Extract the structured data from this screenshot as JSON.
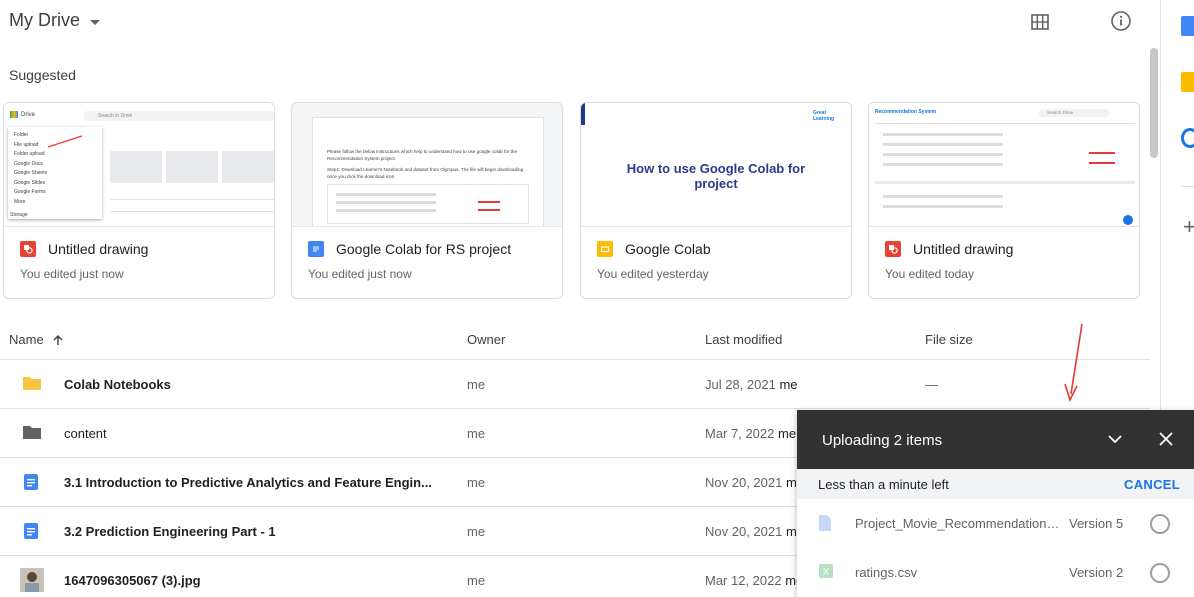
{
  "header": {
    "title": "My Drive"
  },
  "suggested": {
    "label": "Suggested",
    "cards": [
      {
        "name": "Untitled drawing",
        "edited": "You edited just now",
        "icon": "drawings-icon",
        "thumb_text": "",
        "thumb_mini": {
          "drive_label": "Drive",
          "search_placeholder": "Search in Drive",
          "menu_items": [
            "Folder",
            "File upload",
            "Folder upload",
            "Google Docs",
            "Google Sheets",
            "Google Slides",
            "Google Forms",
            "More"
          ],
          "storage_label": "Storage"
        }
      },
      {
        "name": "Google Colab for RS project",
        "edited": "You edited just now",
        "icon": "docs-icon",
        "thumb_text": "",
        "thumb_doc_line": "Please follow the below instructions which help to understand how to use google colab for the Recommendation System project.",
        "thumb_doc_step": "Step1: Download Learner's Notebook and dataset from Olympus. The file will begin downloading once you click the download icon."
      },
      {
        "name": "Google Colab",
        "edited": "You edited yesterday",
        "icon": "slides-icon",
        "thumb_text": "How to use Google Colab for project",
        "thumb_logo": "Great Learning"
      },
      {
        "name": "Untitled drawing",
        "edited": "You edited today",
        "icon": "drawings-icon",
        "thumb_text": "",
        "thumb_mini": {
          "header": "Recommendation System",
          "search_placeholder": "Search Drive"
        }
      }
    ]
  },
  "table": {
    "columns": {
      "name": "Name",
      "owner": "Owner",
      "modified": "Last modified",
      "size": "File size"
    },
    "rows": [
      {
        "name": "Colab Notebooks",
        "owner": "me",
        "modified": "Jul 28, 2021",
        "modified_by": "me",
        "size": "—",
        "icon": "folder-yellow-icon"
      },
      {
        "name": "content",
        "owner": "me",
        "modified": "Mar 7, 2022",
        "modified_by": "me",
        "size": "",
        "icon": "folder-gray-icon"
      },
      {
        "name": "3.1 Introduction to Predictive Analytics and Feature Engin...",
        "owner": "me",
        "modified": "Nov 20, 2021",
        "modified_by": "me",
        "size": "",
        "icon": "docs-icon"
      },
      {
        "name": "3.2 Prediction Engineering Part - 1",
        "owner": "me",
        "modified": "Nov 20, 2021",
        "modified_by": "me",
        "size": "",
        "icon": "docs-icon"
      },
      {
        "name": "1647096305067 (3).jpg",
        "owner": "me",
        "modified": "Mar 12, 2022",
        "modified_by": "me",
        "size": "",
        "icon": "image-thumb-icon"
      }
    ]
  },
  "upload_panel": {
    "title": "Uploading 2 items",
    "status": "Less than a minute left",
    "cancel_label": "CANCEL",
    "items": [
      {
        "name": "Project_Movie_Recommendation_Systems.ipynb",
        "version": "Version 5",
        "icon": "file-icon"
      },
      {
        "name": "ratings.csv",
        "version": "Version 2",
        "icon": "sheets-icon"
      }
    ]
  },
  "colors": {
    "accent": "#1a73e8",
    "drawings": "#e94235",
    "docs": "#4285f4",
    "slides": "#fbbc04",
    "sheets": "#34a853",
    "folder_yellow": "#f7c443",
    "folder_gray": "#5f6368",
    "upload_header": "#323232",
    "annotation_arrow": "#e53935"
  }
}
